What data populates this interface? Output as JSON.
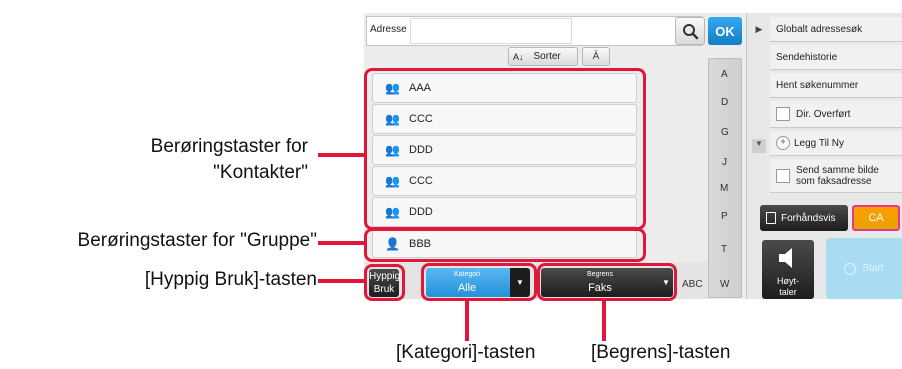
{
  "callouts": {
    "contacts_line1": "Berøringstaster for",
    "contacts_line2": "\"Kontakter\"",
    "group": "Berøringstaster for \"Gruppe\"",
    "frequent": "[Hyppig Bruk]-tasten",
    "category": "[Kategori]-tasten",
    "limit": "[Begrens]-tasten"
  },
  "search": {
    "label": "Adresse",
    "value": "",
    "ok_label": "OK"
  },
  "sort": {
    "label": "Sorter",
    "sort_icon_text": "A↓",
    "toggle_icon_text": "Ā"
  },
  "contacts": [
    {
      "name": "AAA",
      "type": "contact"
    },
    {
      "name": "CCC",
      "type": "contact"
    },
    {
      "name": "DDD",
      "type": "contact"
    },
    {
      "name": "CCC",
      "type": "contact"
    },
    {
      "name": "DDD",
      "type": "contact"
    }
  ],
  "group_entry": {
    "name": "BBB",
    "type": "group"
  },
  "alphabet_index": [
    "A",
    "D",
    "G",
    "J",
    "M",
    "P",
    "T",
    "W"
  ],
  "abc_label": "ABC",
  "bottom_bar": {
    "frequent_line1": "Hyppig",
    "frequent_line2": "Bruk",
    "category_caption": "Kategori",
    "category_value": "Alle",
    "limit_caption": "Begrens",
    "limit_value": "Faks"
  },
  "right_panel": {
    "global_search": "Globalt adressesøk",
    "send_history": "Sendehistorie",
    "get_search_number": "Hent søkenummer",
    "direct_transfer": "Dir. Overført",
    "add_new": "Legg Til Ny",
    "same_image_line1": "Send samme bilde",
    "same_image_line2": "som faksadresse",
    "preview": "Forhåndsvis",
    "ca": "CA",
    "speaker_line1": "Høyt-",
    "speaker_line2": "taler",
    "start": "Start"
  },
  "colors": {
    "accent_blue": "#1a8fd8",
    "callout_red": "#e0173a",
    "ca_pink": "#e2388f",
    "start_disabled": "#a9dbf3"
  }
}
